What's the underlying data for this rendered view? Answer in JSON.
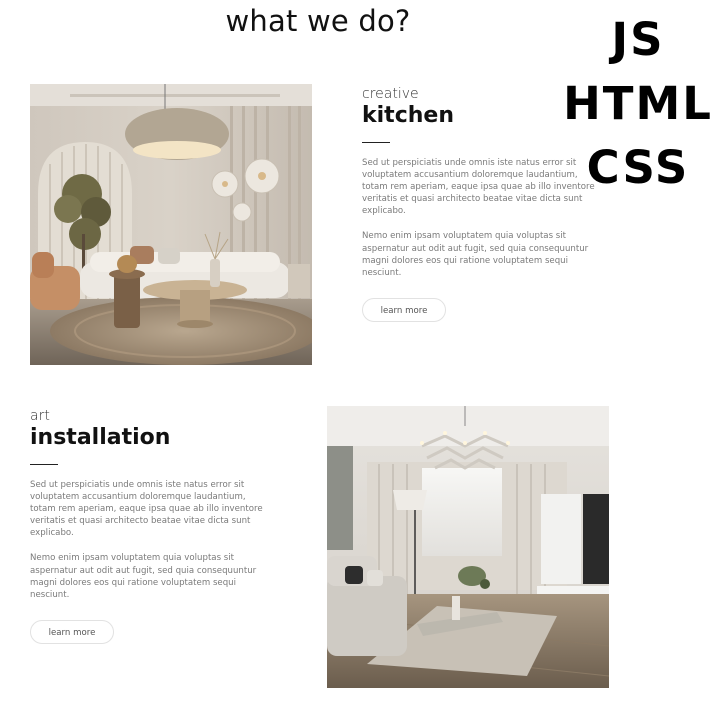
{
  "page": {
    "title": "what we do?"
  },
  "tech_stack": [
    "JS",
    "HTML",
    "CSS"
  ],
  "sections": [
    {
      "eyebrow": "creative",
      "heading": "kitchen",
      "paragraphs": [
        "Sed ut perspiciatis unde omnis iste natus error sit voluptatem accusantium doloremque laudantium, totam rem aperiam, eaque ipsa quae ab illo inventore veritatis et quasi architecto beatae vitae dicta sunt explicabo.",
        "Nemo enim ipsam voluptatem quia voluptas sit aspernatur aut odit aut fugit, sed quia consequuntur magni dolores eos qui ratione voluptatem sequi nesciunt."
      ],
      "button_label": "learn more"
    },
    {
      "eyebrow": "art",
      "heading": "installation",
      "paragraphs": [
        "Sed ut perspiciatis unde omnis iste natus error sit voluptatem accusantium doloremque laudantium, totam rem aperiam, eaque ipsa quae ab illo inventore veritatis et quasi architecto beatae vitae dicta sunt explicabo.",
        "Nemo enim ipsam voluptatem quia voluptas sit aspernatur aut odit aut fugit, sed quia consequuntur magni dolores eos qui ratione voluptatem sequi nesciunt."
      ],
      "button_label": "learn more"
    }
  ]
}
